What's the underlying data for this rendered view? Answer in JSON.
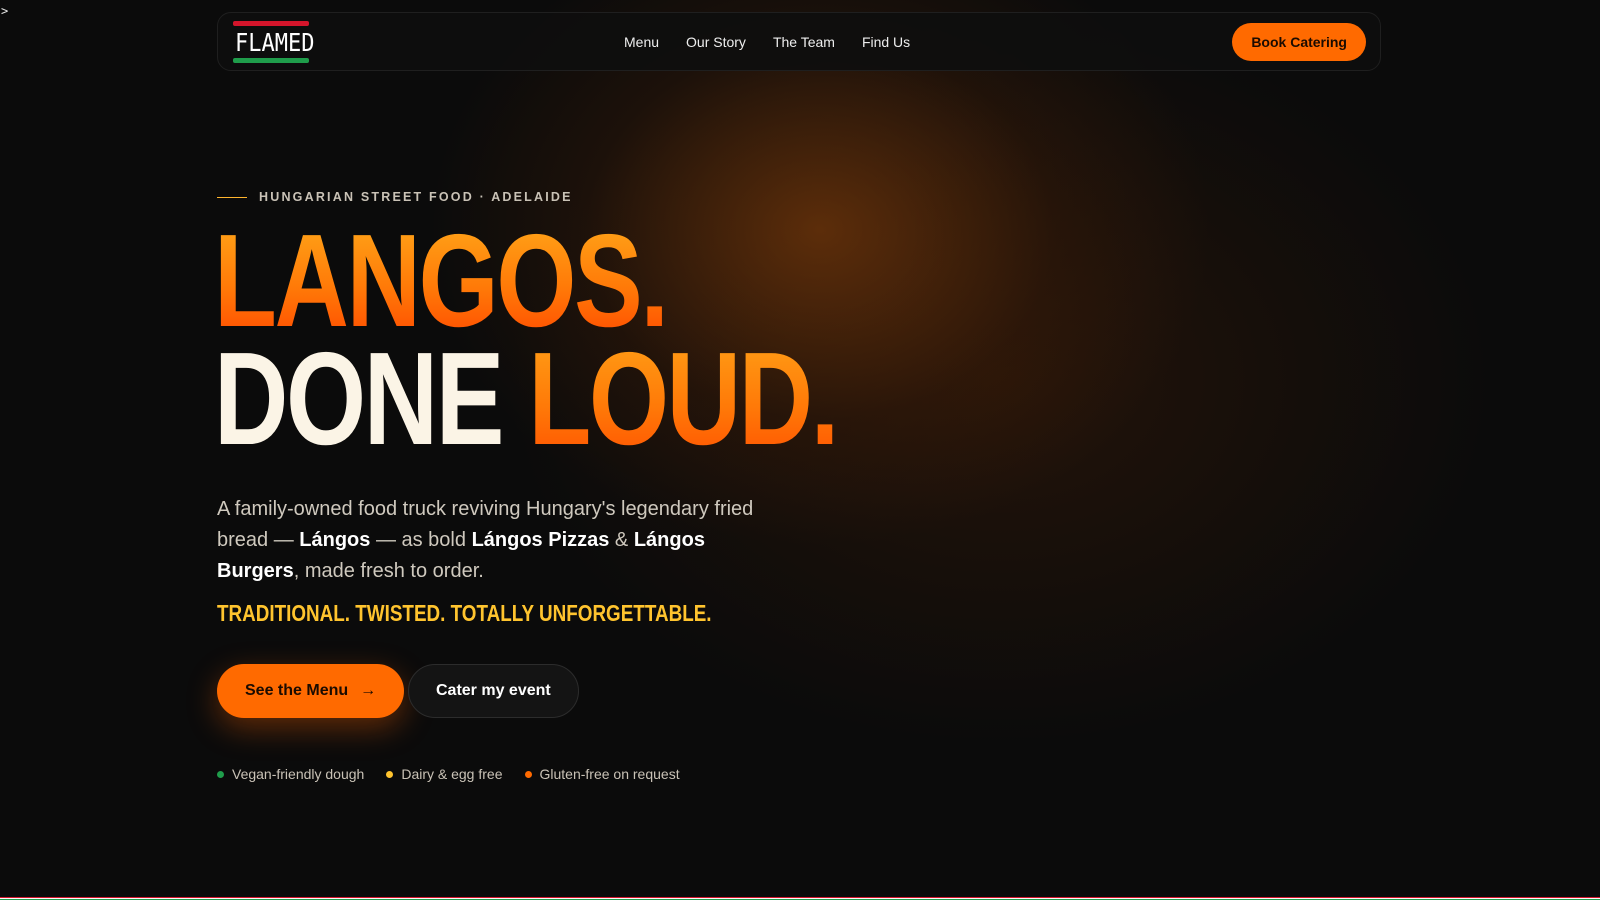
{
  "prompt_glyph": ">",
  "nav": {
    "logo_text": "FLAMED",
    "links": [
      "Menu",
      "Our Story",
      "The Team",
      "Find Us"
    ],
    "cta_label": "Book Catering"
  },
  "hero": {
    "eyebrow": "HUNGARIAN STREET FOOD · ADELAIDE",
    "headline_line1": "LANGOS.",
    "headline_line2_plain": "DONE",
    "headline_line2_accent": "LOUD.",
    "desc_part1": "A family-owned food truck reviving Hungary's legendary fried bread — ",
    "desc_bold1": "Lángos",
    "desc_part2": " — as bold ",
    "desc_bold2": "Lángos Pizzas",
    "desc_part3": " & ",
    "desc_bold3": "Lángos Burgers",
    "desc_part4": ", made fresh to order.",
    "tagline": "TRADITIONAL. TWISTED. TOTALLY UNFORGETTABLE.",
    "primary_button": "See the Menu",
    "primary_button_icon": "→",
    "secondary_button": "Cater my event"
  },
  "badges": [
    {
      "label": "Vegan-friendly dough",
      "color": "#1f9d4b"
    },
    {
      "label": "Dairy & egg free",
      "color": "#ffc42e"
    },
    {
      "label": "Gluten-free on request",
      "color": "#ff6a00"
    }
  ],
  "colors": {
    "accent": "#ff6a00",
    "tagline": "#ffc42e",
    "background": "#0b0b0b",
    "flag_red": "#d4152b",
    "flag_green": "#1f9d4b"
  }
}
